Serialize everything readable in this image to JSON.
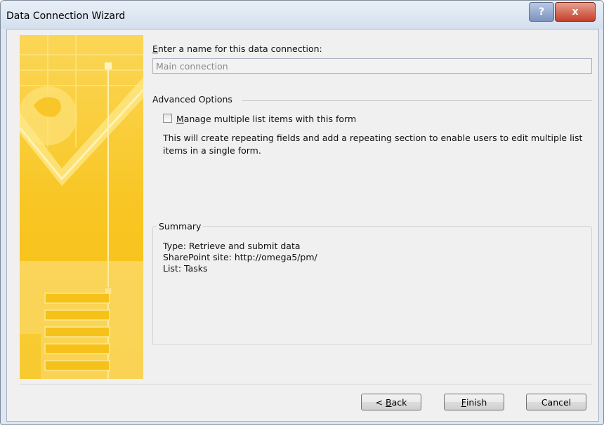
{
  "window": {
    "title": "Data Connection Wizard",
    "help_glyph": "?",
    "close_glyph": "x"
  },
  "name_field": {
    "label_accel": "E",
    "label_rest": "nter a name for this data connection:",
    "value": "Main connection"
  },
  "advanced": {
    "group_label": "Advanced Options",
    "checkbox_accel": "M",
    "checkbox_rest": "anage multiple list items with this form",
    "checkbox_checked": false,
    "description": "This will create repeating fields and add a repeating section to enable users to edit multiple list items in a single form."
  },
  "summary": {
    "title": "Summary",
    "lines": [
      "Type: Retrieve and submit data",
      "SharePoint site: http://omega5/pm/",
      "List: Tasks"
    ]
  },
  "buttons": {
    "back_prefix": "< ",
    "back_accel": "B",
    "back_rest": "ack",
    "finish_accel": "F",
    "finish_rest": "inish",
    "cancel": "Cancel"
  },
  "colors": {
    "art_yellow": "#f7c21a",
    "art_light": "#fde27a",
    "title_bar": "#dfe8f2",
    "close_red": "#c2402a"
  },
  "icons": {
    "help": "help-icon",
    "close": "close-icon",
    "art": "wizard-banner-art"
  }
}
